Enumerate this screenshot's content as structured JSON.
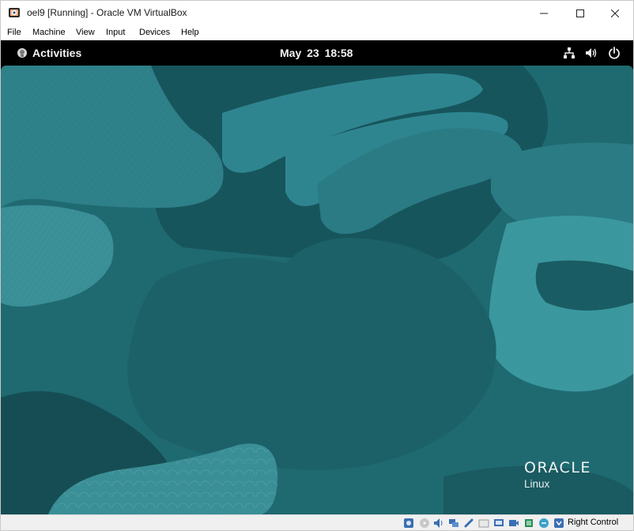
{
  "window": {
    "title": "oel9 [Running] - Oracle VM VirtualBox"
  },
  "menu": {
    "items": [
      "File",
      "Machine",
      "View",
      "Input",
      "Devices",
      "Help"
    ]
  },
  "gnome_topbar": {
    "activities_label": "Activities",
    "date": "May 23",
    "time": "18:58",
    "tray_icons": [
      "network-wired-icon",
      "volume-icon",
      "power-icon"
    ]
  },
  "desktop": {
    "brand_name": "ORACLE",
    "brand_sub": "Linux",
    "colors": {
      "base": "#1f6a70",
      "dark": "#164d54",
      "light": "#2e8590",
      "lighter": "#3a979e"
    }
  },
  "statusbar": {
    "icons": [
      "hard-disk-icon",
      "optical-drive-icon",
      "audio-icon",
      "network-icon",
      "usb-icon",
      "shared-folders-icon",
      "display-icon",
      "recording-icon",
      "cpu-icon",
      "mouse-integration-icon",
      "keyboard-icon"
    ],
    "host_key_label": "Right Control"
  }
}
